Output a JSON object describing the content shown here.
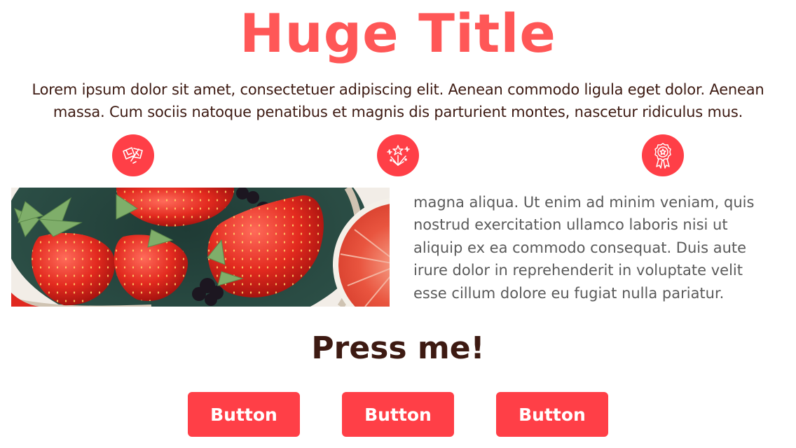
{
  "colors": {
    "accent": "#ff5757",
    "button": "#ff3f47",
    "heading": "#3d1a12",
    "body": "#5a5a5a"
  },
  "hero": {
    "title": "Huge Title",
    "intro": "Lorem ipsum dolor sit amet, consectetuer adipiscing elit. Aenean commodo ligula eget dolor. Aenean massa. Cum sociis natoque penatibus et magnis dis parturient montes, nascetur ridiculus mus."
  },
  "features": {
    "icons": [
      "flags-icon",
      "fireworks-icon",
      "award-ribbon-icon"
    ]
  },
  "content": {
    "body_text": "magna aliqua. Ut enim ad minim veniam, quis nostrud exercitation ullamco laboris nisi ut aliquip ex ea commodo consequat. Duis aute irure dolor in reprehenderit in voluptate velit esse cillum dolore eu fugiat nulla pariatur."
  },
  "cta": {
    "title": "Press me!",
    "buttons": [
      {
        "label": "Button"
      },
      {
        "label": "Button"
      },
      {
        "label": "Button"
      }
    ]
  }
}
